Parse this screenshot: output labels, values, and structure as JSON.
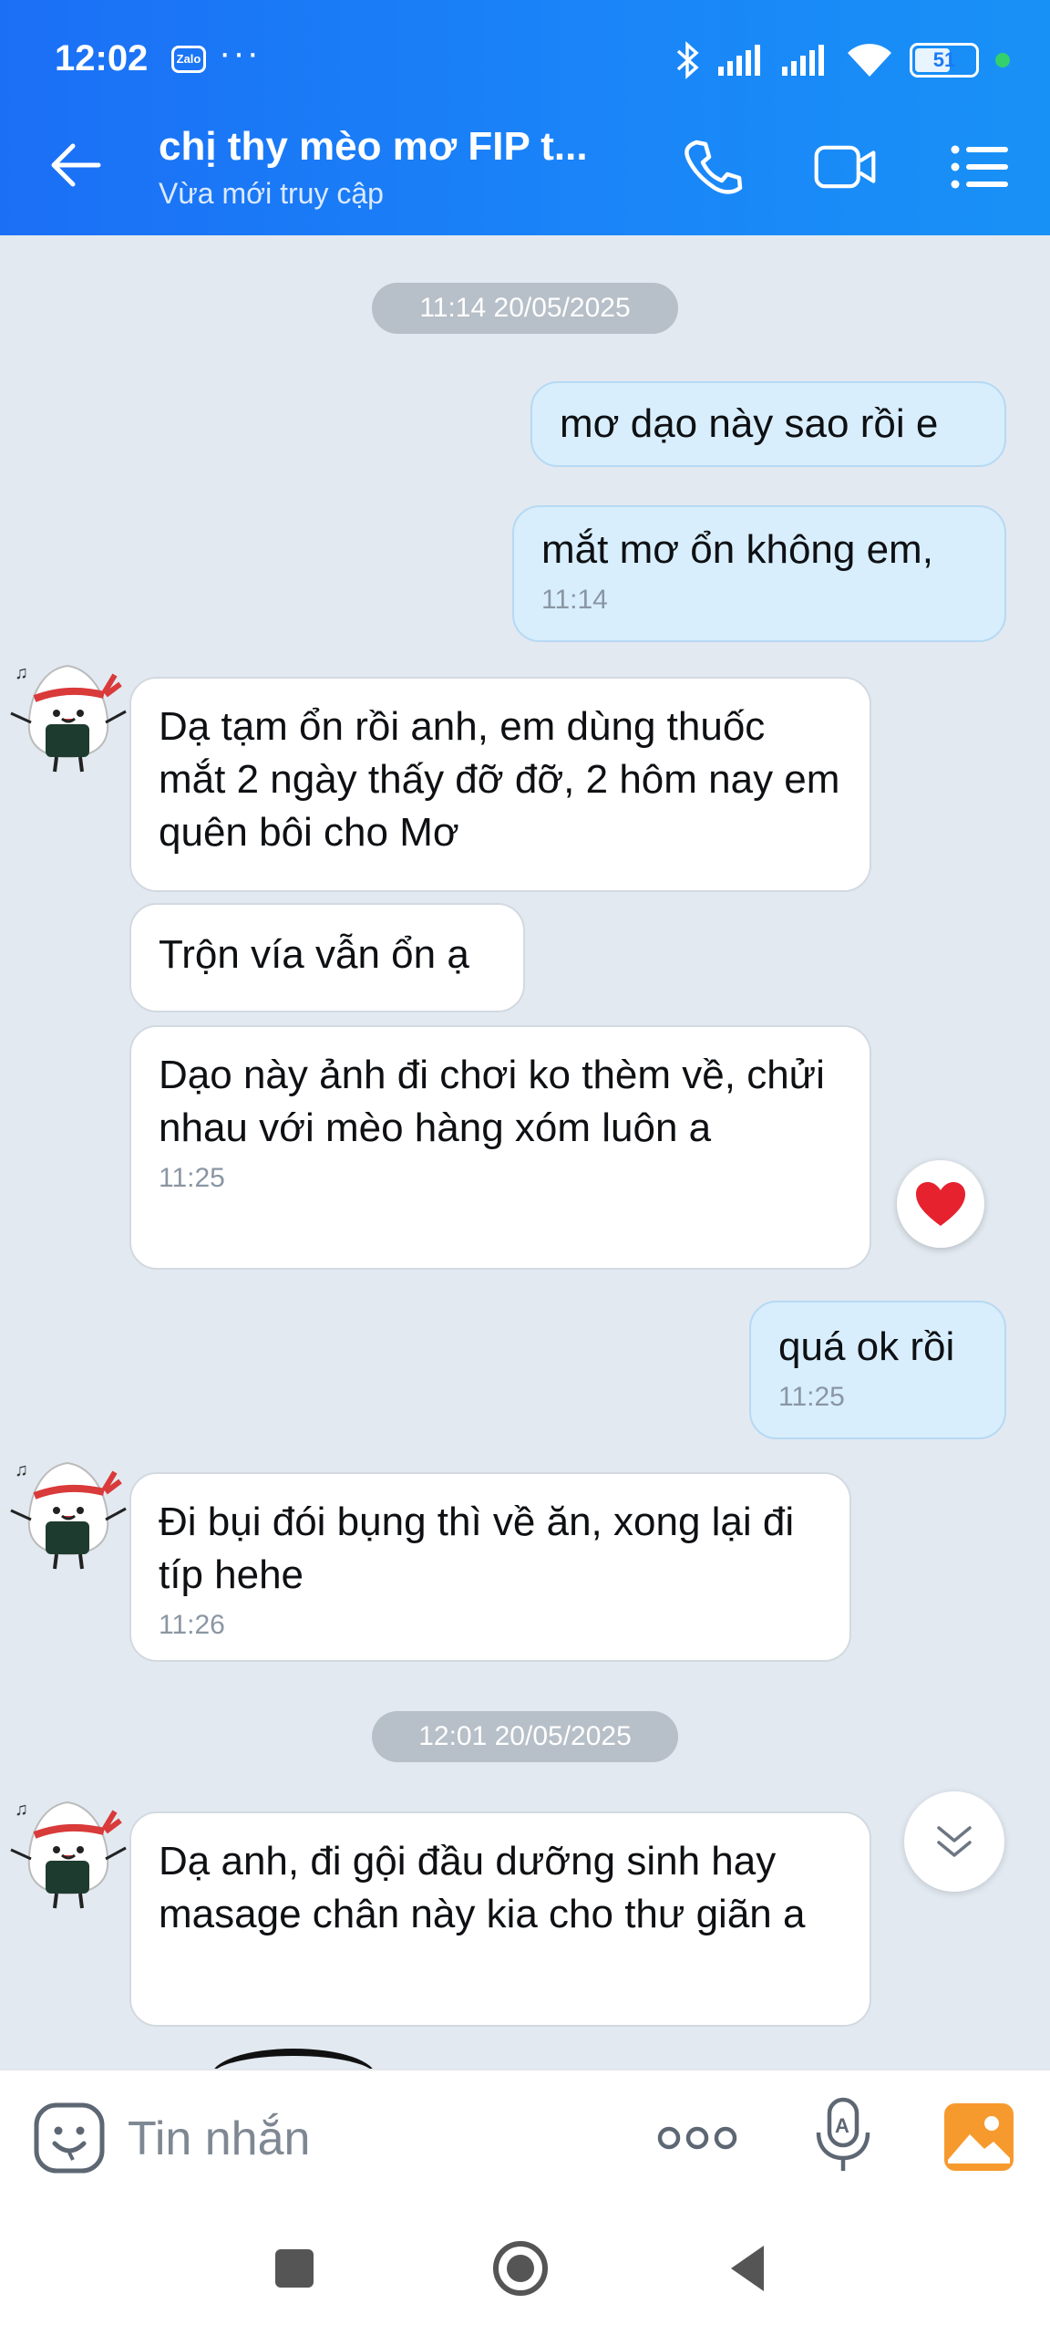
{
  "status_bar": {
    "time": "12:02",
    "app_badge": "Zalo",
    "more": "···",
    "battery": "51"
  },
  "header": {
    "title": "chị thy mèo mơ FIP t...",
    "subtitle": "Vừa mới truy cập"
  },
  "messages": [
    {
      "type": "date",
      "text": "11:14 20/05/2025"
    },
    {
      "type": "out",
      "text": "mơ dạo này sao rồi e"
    },
    {
      "type": "out",
      "text": "mắt mơ ổn không em,",
      "time": "11:14"
    },
    {
      "type": "in",
      "text": "Dạ tạm ổn rồi anh, em dùng thuốc mắt 2 ngày thấy đỡ đỡ, 2 hôm nay em quên bôi cho Mơ"
    },
    {
      "type": "in",
      "text": "Trộn vía vẫn ổn ạ"
    },
    {
      "type": "in",
      "text": "Dạo này ảnh đi chơi ko thèm về, chửi nhau với mèo hàng xóm luôn a",
      "time": "11:25",
      "reaction": "heart"
    },
    {
      "type": "out",
      "text": "quá ok rồi",
      "time": "11:25"
    },
    {
      "type": "in",
      "text": "Đi bụi đói bụng thì về ăn, xong lại đi típ hehe",
      "time": "11:26"
    },
    {
      "type": "date",
      "text": "12:01 20/05/2025"
    },
    {
      "type": "in",
      "text": "Dạ anh, đi gội đầu dưỡng sinh hay masage chân này kia cho thư giãn a"
    }
  ],
  "input": {
    "placeholder": "Tin nhắn"
  },
  "icons": {
    "back": "back-arrow-icon",
    "call": "phone-icon",
    "video": "video-camera-icon",
    "menu": "list-menu-icon",
    "emoji": "emoji-icon",
    "more": "more-dots-icon",
    "mic": "voice-mic-icon",
    "image": "image-gallery-icon",
    "heart": "heart-reaction-icon",
    "scroll": "chevron-double-down-icon"
  },
  "colors": {
    "header": "#1a7af7",
    "outgoing": "#d8eefd",
    "incoming": "#ffffff",
    "background": "#e2e9f1"
  }
}
